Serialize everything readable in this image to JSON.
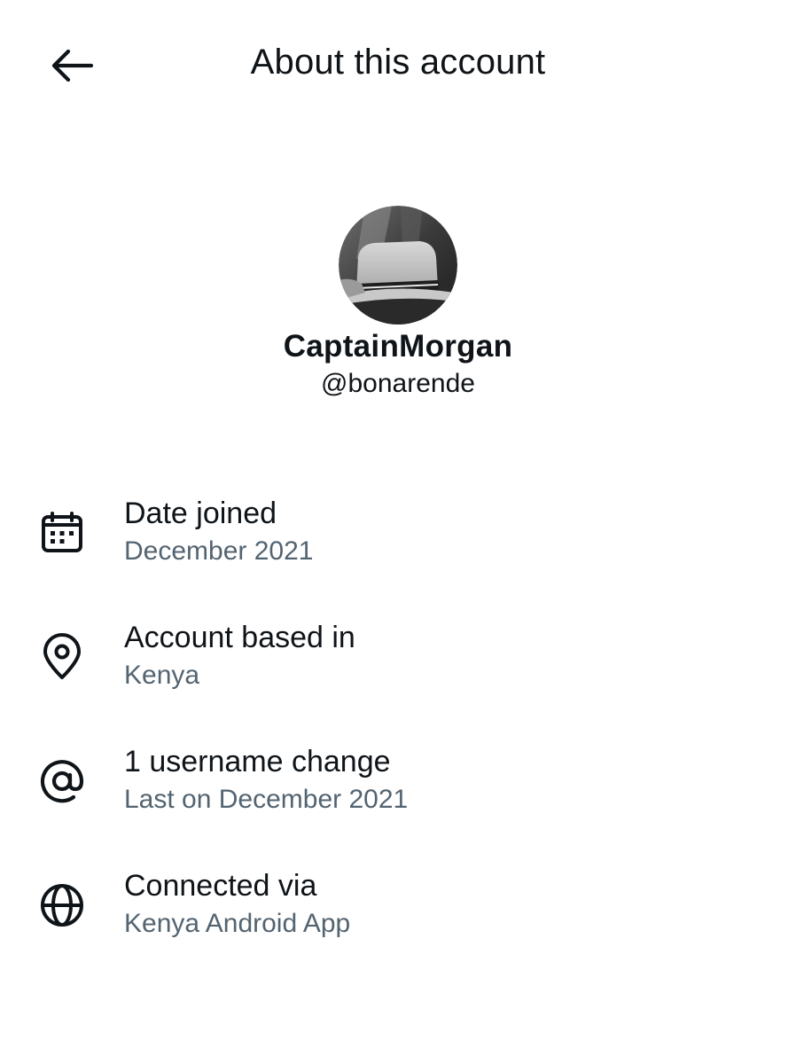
{
  "header": {
    "back_icon": "arrow-left-icon",
    "title": "About this account"
  },
  "profile": {
    "avatar_icon": "avatar-photo-hat",
    "display_name": "CaptainMorgan",
    "handle": "@bonarende"
  },
  "info": [
    {
      "icon": "calendar-icon",
      "label": "Date joined",
      "value": "December 2021"
    },
    {
      "icon": "location-pin-icon",
      "label": "Account based in",
      "value": "Kenya"
    },
    {
      "icon": "at-sign-icon",
      "label": "1 username change",
      "value": "Last on December 2021"
    },
    {
      "icon": "globe-icon",
      "label": "Connected via",
      "value": "Kenya Android App"
    }
  ],
  "colors": {
    "primary_text": "#0f1419",
    "secondary_text": "#536471",
    "background": "#ffffff"
  }
}
